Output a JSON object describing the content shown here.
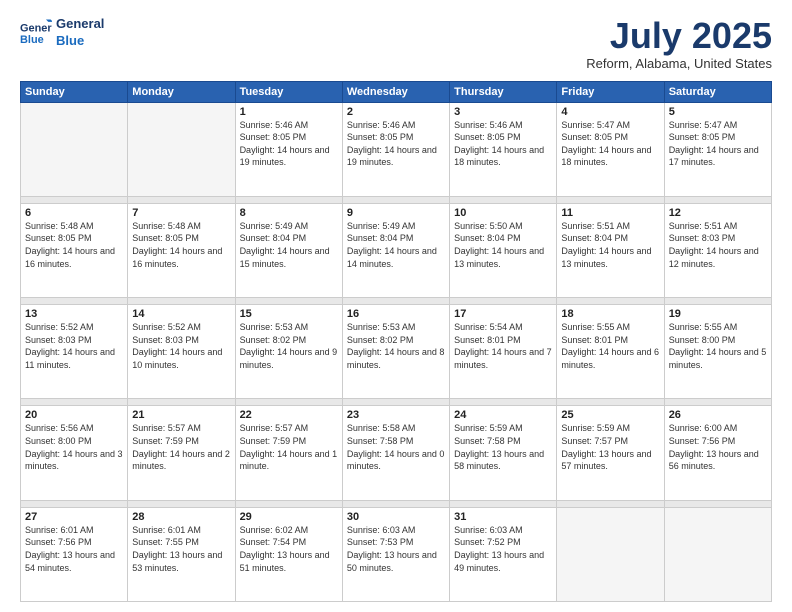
{
  "header": {
    "logo_line1": "General",
    "logo_line2": "Blue",
    "month_year": "July 2025",
    "location": "Reform, Alabama, United States"
  },
  "weekdays": [
    "Sunday",
    "Monday",
    "Tuesday",
    "Wednesday",
    "Thursday",
    "Friday",
    "Saturday"
  ],
  "weeks": [
    [
      {
        "day": "",
        "empty": true
      },
      {
        "day": "",
        "empty": true
      },
      {
        "day": "1",
        "sunrise": "5:46 AM",
        "sunset": "8:05 PM",
        "daylight": "14 hours and 19 minutes."
      },
      {
        "day": "2",
        "sunrise": "5:46 AM",
        "sunset": "8:05 PM",
        "daylight": "14 hours and 19 minutes."
      },
      {
        "day": "3",
        "sunrise": "5:46 AM",
        "sunset": "8:05 PM",
        "daylight": "14 hours and 18 minutes."
      },
      {
        "day": "4",
        "sunrise": "5:47 AM",
        "sunset": "8:05 PM",
        "daylight": "14 hours and 18 minutes."
      },
      {
        "day": "5",
        "sunrise": "5:47 AM",
        "sunset": "8:05 PM",
        "daylight": "14 hours and 17 minutes."
      }
    ],
    [
      {
        "day": "6",
        "sunrise": "5:48 AM",
        "sunset": "8:05 PM",
        "daylight": "14 hours and 16 minutes."
      },
      {
        "day": "7",
        "sunrise": "5:48 AM",
        "sunset": "8:05 PM",
        "daylight": "14 hours and 16 minutes."
      },
      {
        "day": "8",
        "sunrise": "5:49 AM",
        "sunset": "8:04 PM",
        "daylight": "14 hours and 15 minutes."
      },
      {
        "day": "9",
        "sunrise": "5:49 AM",
        "sunset": "8:04 PM",
        "daylight": "14 hours and 14 minutes."
      },
      {
        "day": "10",
        "sunrise": "5:50 AM",
        "sunset": "8:04 PM",
        "daylight": "14 hours and 13 minutes."
      },
      {
        "day": "11",
        "sunrise": "5:51 AM",
        "sunset": "8:04 PM",
        "daylight": "14 hours and 13 minutes."
      },
      {
        "day": "12",
        "sunrise": "5:51 AM",
        "sunset": "8:03 PM",
        "daylight": "14 hours and 12 minutes."
      }
    ],
    [
      {
        "day": "13",
        "sunrise": "5:52 AM",
        "sunset": "8:03 PM",
        "daylight": "14 hours and 11 minutes."
      },
      {
        "day": "14",
        "sunrise": "5:52 AM",
        "sunset": "8:03 PM",
        "daylight": "14 hours and 10 minutes."
      },
      {
        "day": "15",
        "sunrise": "5:53 AM",
        "sunset": "8:02 PM",
        "daylight": "14 hours and 9 minutes."
      },
      {
        "day": "16",
        "sunrise": "5:53 AM",
        "sunset": "8:02 PM",
        "daylight": "14 hours and 8 minutes."
      },
      {
        "day": "17",
        "sunrise": "5:54 AM",
        "sunset": "8:01 PM",
        "daylight": "14 hours and 7 minutes."
      },
      {
        "day": "18",
        "sunrise": "5:55 AM",
        "sunset": "8:01 PM",
        "daylight": "14 hours and 6 minutes."
      },
      {
        "day": "19",
        "sunrise": "5:55 AM",
        "sunset": "8:00 PM",
        "daylight": "14 hours and 5 minutes."
      }
    ],
    [
      {
        "day": "20",
        "sunrise": "5:56 AM",
        "sunset": "8:00 PM",
        "daylight": "14 hours and 3 minutes."
      },
      {
        "day": "21",
        "sunrise": "5:57 AM",
        "sunset": "7:59 PM",
        "daylight": "14 hours and 2 minutes."
      },
      {
        "day": "22",
        "sunrise": "5:57 AM",
        "sunset": "7:59 PM",
        "daylight": "14 hours and 1 minute."
      },
      {
        "day": "23",
        "sunrise": "5:58 AM",
        "sunset": "7:58 PM",
        "daylight": "14 hours and 0 minutes."
      },
      {
        "day": "24",
        "sunrise": "5:59 AM",
        "sunset": "7:58 PM",
        "daylight": "13 hours and 58 minutes."
      },
      {
        "day": "25",
        "sunrise": "5:59 AM",
        "sunset": "7:57 PM",
        "daylight": "13 hours and 57 minutes."
      },
      {
        "day": "26",
        "sunrise": "6:00 AM",
        "sunset": "7:56 PM",
        "daylight": "13 hours and 56 minutes."
      }
    ],
    [
      {
        "day": "27",
        "sunrise": "6:01 AM",
        "sunset": "7:56 PM",
        "daylight": "13 hours and 54 minutes."
      },
      {
        "day": "28",
        "sunrise": "6:01 AM",
        "sunset": "7:55 PM",
        "daylight": "13 hours and 53 minutes."
      },
      {
        "day": "29",
        "sunrise": "6:02 AM",
        "sunset": "7:54 PM",
        "daylight": "13 hours and 51 minutes."
      },
      {
        "day": "30",
        "sunrise": "6:03 AM",
        "sunset": "7:53 PM",
        "daylight": "13 hours and 50 minutes."
      },
      {
        "day": "31",
        "sunrise": "6:03 AM",
        "sunset": "7:52 PM",
        "daylight": "13 hours and 49 minutes."
      },
      {
        "day": "",
        "empty": true
      },
      {
        "day": "",
        "empty": true
      }
    ]
  ],
  "labels": {
    "sunrise": "Sunrise:",
    "sunset": "Sunset:",
    "daylight": "Daylight:"
  }
}
